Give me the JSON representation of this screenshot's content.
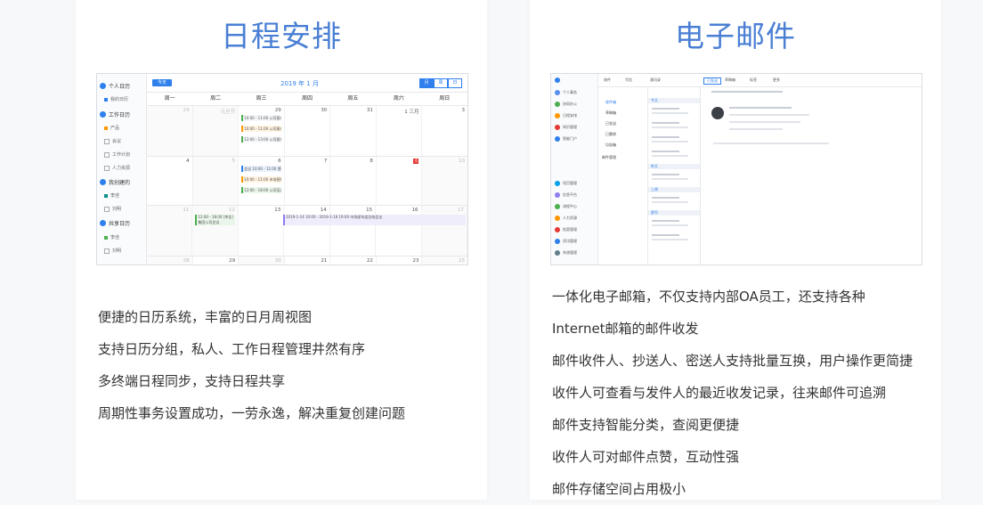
{
  "calendar_card": {
    "title": "日程安排",
    "screenshot": {
      "sidebar": {
        "groups": [
          "个人日历",
          "工作日历",
          "我创建的",
          "共享日历"
        ],
        "items": [
          "我的日历",
          "产品",
          "会议",
          "工作计划",
          "人力资源",
          "李佳",
          "刘明",
          "李佳",
          "刘明"
        ]
      },
      "toolbar": {
        "today": "今天",
        "month_label": "2019 年 1 月",
        "views": [
          "月",
          "周",
          "日"
        ]
      },
      "weekdays": [
        "周一",
        "周二",
        "周三",
        "周四",
        "周五",
        "周六",
        "周日"
      ],
      "weeks": [
        [
          "24",
          "元旦节",
          "29",
          "30",
          "31",
          "1 三月",
          "3"
        ],
        [
          "4",
          "5",
          "6",
          "7",
          "8",
          "9",
          "10"
        ],
        [
          "11",
          "12",
          "13",
          "14",
          "15",
          "16",
          "17"
        ],
        [
          "28",
          "29",
          "30",
          "21",
          "22",
          "23",
          "25"
        ]
      ],
      "events": {
        "e1": "10:00 - 11:00 公司客户拜访",
        "e2": "10:00 - 11:00 公司客户拜访",
        "e3": "12:00 - 13:00 公司客户拜访",
        "e4": "会议 10:00 - 11:00 营销讨论",
        "e5": "10:00 - 11:00 市场营销报告",
        "e6": "12:00 - 18:00 公司培训",
        "e7": "12:00 - 18:00 [李佳] 集团公司会议",
        "e8": "2019-1-14 10:00 - 2019-1-18 19:00 市场部年度总结会议"
      },
      "badge": "6"
    },
    "features": [
      "便捷的日历系统，丰富的日月周视图",
      "支持日历分组，私人、工作日程管理井然有序",
      "多终端日程同步，支持日程共享",
      "周期性事务设置成功，一劳永逸，解决重复创建问题"
    ]
  },
  "mail_card": {
    "title": "电子邮件",
    "screenshot": {
      "nav": [
        "个人事务",
        "协同办公",
        "日程安排",
        "知识管理",
        "智能门户",
        "项目管理",
        "信息平台",
        "流程中心",
        "人力资源",
        "档案管理",
        "资讯管理",
        "系统管理",
        "应用模板"
      ],
      "top": [
        "收件",
        "写信",
        "通讯录",
        "已发送",
        "草稿箱",
        "标签",
        "更多"
      ],
      "folders": [
        "收件箱",
        "草稿箱",
        "已发送",
        "已删除",
        "垃圾箱",
        "邮件管理"
      ],
      "list_sections": [
        "今天",
        "昨天",
        "上周",
        "更早"
      ]
    },
    "features": [
      "一体化电子邮箱，不仅支持内部OA员工，还支持各种",
      "Internet邮箱的邮件收发",
      "邮件收件人、抄送人、密送人支持批量互换，用户操作更简捷",
      "收件人可查看与发件人的最近收发记录，往来邮件可追溯",
      "邮件支持智能分类，查阅更便捷",
      "收件人可对邮件点赞，互动性强",
      "邮件存储空间占用极小"
    ]
  }
}
